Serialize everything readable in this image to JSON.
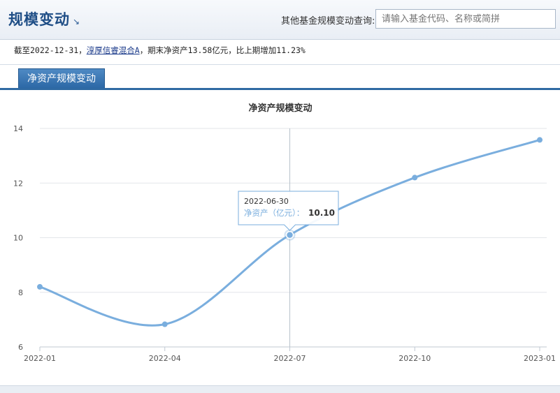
{
  "header": {
    "title": "规模变动",
    "title_arrow": "↘",
    "search_label": "其他基金规模变动查询:",
    "search_placeholder": "请输入基金代码、名称或简拼"
  },
  "summary": {
    "prefix": "截至2022-12-31，",
    "fund_link": "淳厚信睿混合A",
    "suffix": "，期末净资产13.58亿元，比上期增加11.23%"
  },
  "tabs": [
    {
      "label": "净资产规模变动",
      "active": true
    }
  ],
  "chart_data": {
    "type": "line",
    "title": "净资产规模变动",
    "x": [
      "2022-01",
      "2022-04",
      "2022-07",
      "2022-10",
      "2023-01"
    ],
    "ylim": [
      6,
      14
    ],
    "yticks": [
      6,
      8,
      10,
      12,
      14
    ],
    "grid": true,
    "series": [
      {
        "name": "净资产（亿元）",
        "values": [
          8.2,
          6.83,
          10.1,
          12.2,
          13.58
        ],
        "color": "#7aaede"
      }
    ],
    "tooltip": {
      "date": "2022-06-30",
      "label": "净资产（亿元）",
      "value": "10.10",
      "point_index": 2
    }
  }
}
